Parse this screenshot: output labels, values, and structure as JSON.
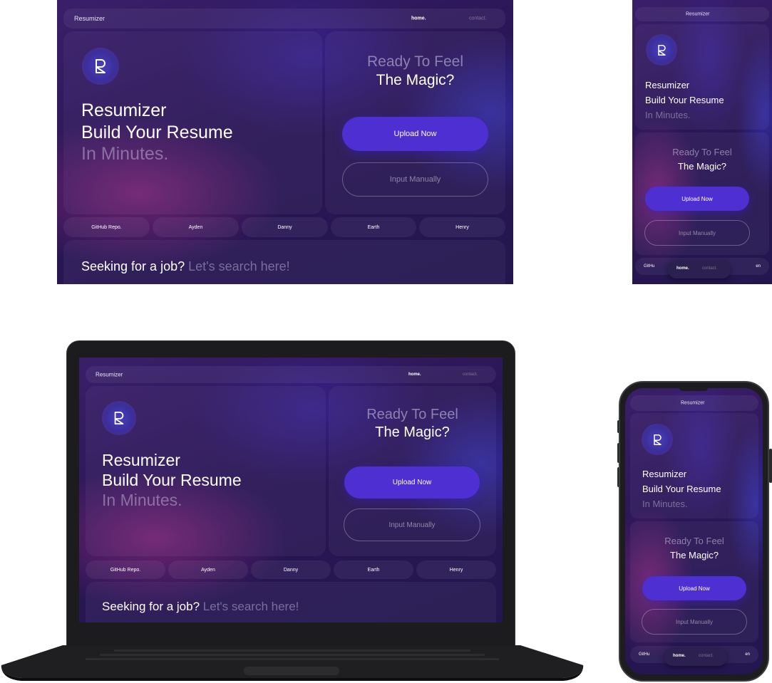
{
  "nav": {
    "brand": "Resumizer",
    "home": "home.",
    "contact": "contact."
  },
  "hero": {
    "line1": "Resumizer",
    "line2": "Build Your Resume",
    "line3": "In Minutes."
  },
  "cta": {
    "line1": "Ready To Feel",
    "line2": "The Magic?",
    "upload": "Upload Now",
    "manual": "Input Manually"
  },
  "links": [
    "GitHub Repo.",
    "Ayden",
    "Danny",
    "Earth",
    "Henry"
  ],
  "mobile_partial": {
    "left": "GitHu",
    "right": "en"
  },
  "seek": {
    "strong": "Seeking for a job?",
    "dim": "Let's search here!"
  },
  "colors": {
    "accent": "#4d2fd2",
    "background": "#2a1656"
  },
  "icons": {
    "logo": "resumizer-r-logo-icon"
  }
}
